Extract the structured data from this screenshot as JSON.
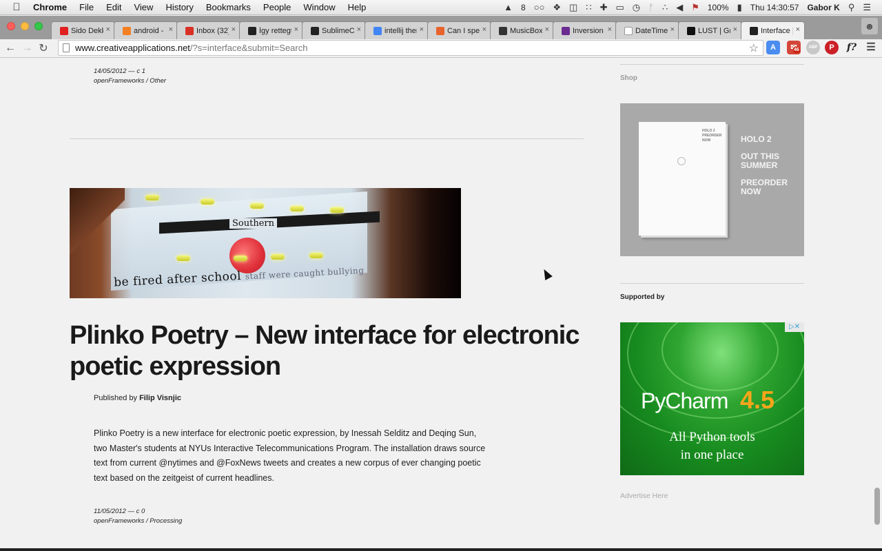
{
  "menubar": {
    "app": "Chrome",
    "items": [
      "File",
      "Edit",
      "View",
      "History",
      "Bookmarks",
      "People",
      "Window",
      "Help"
    ],
    "tray": {
      "adobe_count": "8",
      "battery": "100%",
      "clock": "Thu 14:30:57",
      "user": "Gabor K"
    }
  },
  "tabs": [
    {
      "title": "Sido Dekke",
      "favicon_color": "#e02020"
    },
    {
      "title": "android - c",
      "favicon_color": "#f48024"
    },
    {
      "title": "Inbox (32)",
      "favicon_color": "#d93025"
    },
    {
      "title": "Így rettegt",
      "favicon_color": "#222222"
    },
    {
      "title": "SublimeCo",
      "favicon_color": "#222222"
    },
    {
      "title": "intellij ther",
      "favicon_color": "#4285f4"
    },
    {
      "title": "Can I spec",
      "favicon_color": "#e8642c"
    },
    {
      "title": "MusicBox",
      "favicon_color": "#333333"
    },
    {
      "title": "Inversion o",
      "favicon_color": "#6a2c91"
    },
    {
      "title": "DateTimeF",
      "favicon_color": "#ffffff"
    },
    {
      "title": "LUST | Gra",
      "favicon_color": "#111111"
    },
    {
      "title": "Interface |",
      "favicon_color": "#222222",
      "active": true
    }
  ],
  "toolbar": {
    "url_host": "www.creativeapplications.net",
    "url_path": "/?s=interface&submit=Search",
    "mail_badge": "46",
    "abp_label": "ABP",
    "fquery_label": "f?"
  },
  "page": {
    "top_meta": {
      "date_comments": "14/05/2012 — c 1",
      "categories": "openFrameworks / Other"
    },
    "hero_image": {
      "bar_label": "Southern",
      "poem_line": "be  fired  after  school",
      "poem_fade": "staff were caught bullying"
    },
    "post": {
      "title": "Plinko Poetry – New interface for electronic poetic expression",
      "byline_prefix": "Published by",
      "author": "Filip Visnjic",
      "excerpt": "Plinko Poetry is a new interface for electronic poetic expression, by Inessah Selditz and Deqing Sun, two Master's students at NYUs Interactive Telecommunications Program. The installation draws source text from current @nytimes and @FoxNews tweets and creates a new corpus of ever changing poetic text based on the zeitgeist of current headlines."
    },
    "bottom_meta": {
      "date_comments": "11/05/2012 — c 0",
      "categories": "openFrameworks / Processing"
    }
  },
  "sidebar": {
    "shop_label": "Shop",
    "shop_ad": {
      "book_title_1": "HOLO 2",
      "book_title_2": "PREORDER NOW",
      "line1": "HOLO 2",
      "line2": "OUT THIS SUMMER",
      "line3": "PREORDER NOW"
    },
    "supported_label": "Supported by",
    "pycharm_ad": {
      "name": "PyCharm",
      "version": "4.5",
      "tagline_1": "All Python tools",
      "tagline_2": "in one place",
      "adchoices": "▷✕"
    },
    "advertise": "Advertise Here"
  }
}
